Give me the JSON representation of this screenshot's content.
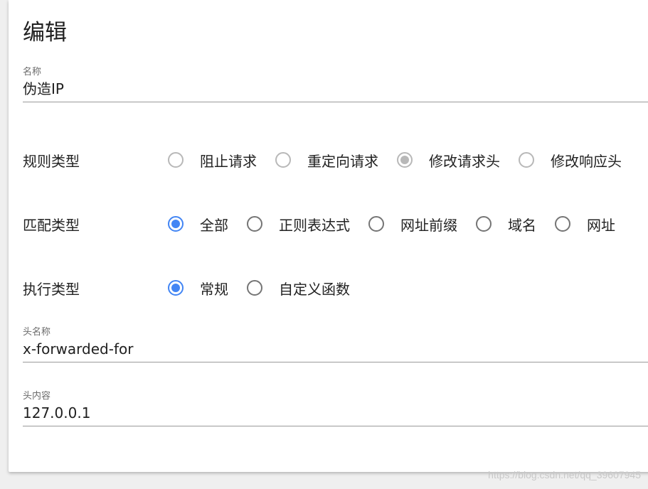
{
  "form": {
    "title": "编辑",
    "name_field": {
      "label": "名称",
      "value": "伪造IP"
    },
    "rule_type": {
      "label": "规则类型",
      "options": [
        "阻止请求",
        "重定向请求",
        "修改请求头",
        "修改响应头"
      ],
      "selected": 2,
      "disabled": true
    },
    "match_type": {
      "label": "匹配类型",
      "options": [
        "全部",
        "正则表达式",
        "网址前缀",
        "域名",
        "网址"
      ],
      "selected": 0
    },
    "exec_type": {
      "label": "执行类型",
      "options": [
        "常规",
        "自定义函数"
      ],
      "selected": 0
    },
    "header_name": {
      "label": "头名称",
      "value": "x-forwarded-for"
    },
    "header_value": {
      "label": "头内容",
      "value": "127.0.0.1"
    }
  },
  "watermark": "https://blog.csdn.net/qq_39607945",
  "colors": {
    "accent": "#4285f4",
    "radio_border": "#757575",
    "disabled": "#b8b8b8"
  }
}
